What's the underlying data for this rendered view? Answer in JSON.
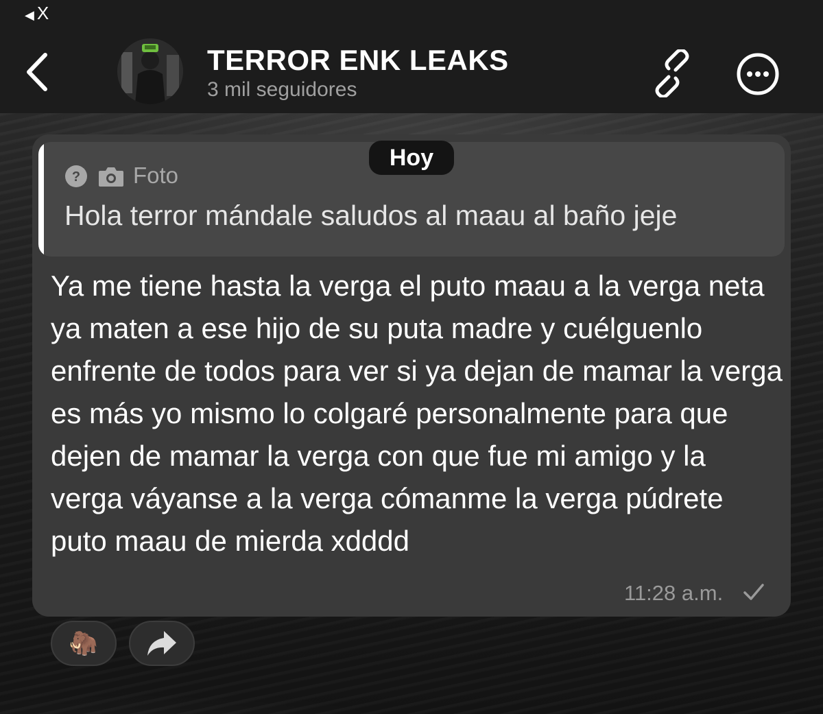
{
  "status_bar": {
    "back_label": "X"
  },
  "header": {
    "channel_name": "TERROR ENK LEAKS",
    "subtitle": "3 mil seguidores"
  },
  "date_separator": "Hoy",
  "message": {
    "reply": {
      "type_label": "Foto",
      "quoted_text": "Hola terror mándale saludos al maau al baño jeje"
    },
    "text": "Ya me tiene hasta la verga el puto maau a la verga neta ya maten a ese hijo de su puta madre y cuélguenlo enfrente de todos para ver si ya dejan de mamar la verga es más yo mismo lo colgaré personalmente para que dejen de mamar la verga con que fue mi amigo y la verga váyanse a la verga cómanme la verga púdrete puto maau de mierda xdddd",
    "time": "11:28 a.m.",
    "reaction_emoji": "🦣"
  },
  "colors": {
    "header_bg": "#1c1c1c",
    "bubble_bg": "#3a3a3a",
    "reply_bg": "#474747",
    "date_pill_bg": "#141414",
    "muted_text": "#a0a0a0"
  },
  "icons": [
    "back-chevron-icon",
    "link-icon",
    "more-icon",
    "question-icon",
    "camera-icon",
    "check-icon",
    "forward-icon"
  ]
}
